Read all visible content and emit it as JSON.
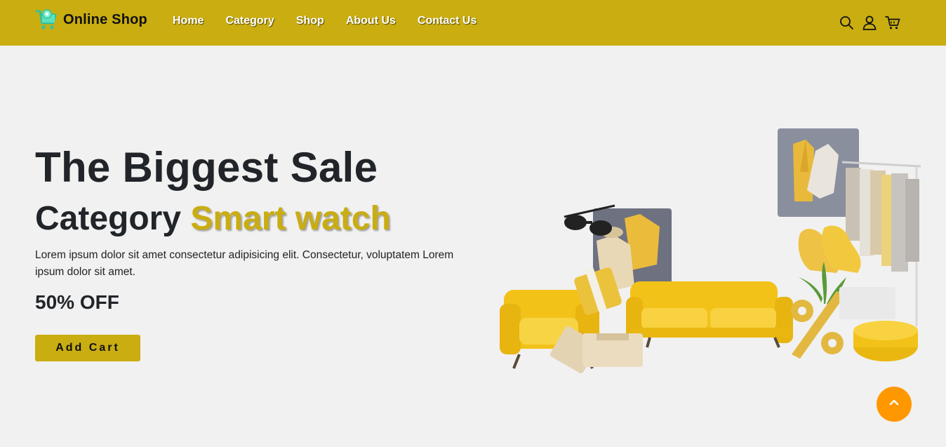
{
  "brand": {
    "name": "Online Shop",
    "icon": "shopping-cart-icon",
    "icon_color": "#2ec4a0"
  },
  "nav": {
    "links": [
      "Home",
      "Category",
      "Shop",
      "About Us",
      "Contact Us"
    ],
    "icons": [
      "search-icon",
      "user-icon",
      "cart-icon"
    ]
  },
  "hero": {
    "title": "The Biggest Sale",
    "subtitle_prefix": "Category",
    "subtitle_accent": "Smart watch",
    "description": "Lorem ipsum dolor sit amet consectetur adipisicing elit. Consectetur, voluptatem Lorem ipsum dolor sit amet.",
    "discount": "50% OFF",
    "cta_label": "Add Cart"
  },
  "colors": {
    "accent": "#c9ad11",
    "scroll_button": "#ff9800",
    "background": "#f1f1f1",
    "text": "#212529"
  },
  "scroll_top": {
    "icon": "chevron-up-icon"
  }
}
